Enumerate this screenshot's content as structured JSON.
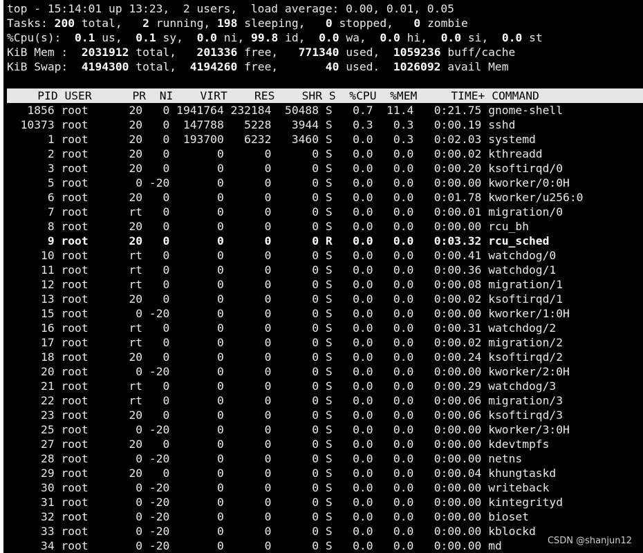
{
  "summary": {
    "line1": "top - 15:14:01 up 13:23,  2 users,  load average: 0.00, 0.01, 0.05",
    "tasks": {
      "label": "Tasks:",
      "total": "200",
      "total_lbl": "total,",
      "running": "2",
      "running_lbl": "running,",
      "sleeping": "198",
      "sleeping_lbl": "sleeping,",
      "stopped": "0",
      "stopped_lbl": "stopped,",
      "zombie": "0",
      "zombie_lbl": "zombie"
    },
    "cpu": {
      "label": "%Cpu(s):",
      "us": "0.1",
      "us_lbl": "us,",
      "sy": "0.1",
      "sy_lbl": "sy,",
      "ni": "0.0",
      "ni_lbl": "ni,",
      "id": "99.8",
      "id_lbl": "id,",
      "wa": "0.0",
      "wa_lbl": "wa,",
      "hi": "0.0",
      "hi_lbl": "hi,",
      "si": "0.0",
      "si_lbl": "si,",
      "st": "0.0",
      "st_lbl": "st"
    },
    "mem": {
      "label": "KiB Mem :",
      "total": "2031912",
      "total_lbl": "total,",
      "free": "201336",
      "free_lbl": "free,",
      "used": "771340",
      "used_lbl": "used,",
      "buff": "1059236",
      "buff_lbl": "buff/cache"
    },
    "swap": {
      "label": "KiB Swap:",
      "total": "4194300",
      "total_lbl": "total,",
      "free": "4194260",
      "free_lbl": "free,",
      "used": "40",
      "used_lbl": "used.",
      "avail": "1026092",
      "avail_lbl": "avail Mem"
    }
  },
  "columns": [
    "PID",
    "USER",
    "PR",
    "NI",
    "VIRT",
    "RES",
    "SHR",
    "S",
    "%CPU",
    "%MEM",
    "TIME+",
    "COMMAND"
  ],
  "processes": [
    [
      "1856",
      "root",
      "20",
      "0",
      "1941764",
      "232184",
      "50488",
      "S",
      "0.7",
      "11.4",
      "0:21.75",
      "gnome-shell"
    ],
    [
      "10373",
      "root",
      "20",
      "0",
      "147788",
      "5228",
      "3944",
      "S",
      "0.3",
      "0.3",
      "0:00.19",
      "sshd"
    ],
    [
      "1",
      "root",
      "20",
      "0",
      "193700",
      "6232",
      "3460",
      "S",
      "0.0",
      "0.3",
      "0:02.03",
      "systemd"
    ],
    [
      "2",
      "root",
      "20",
      "0",
      "0",
      "0",
      "0",
      "S",
      "0.0",
      "0.0",
      "0:00.02",
      "kthreadd"
    ],
    [
      "3",
      "root",
      "20",
      "0",
      "0",
      "0",
      "0",
      "S",
      "0.0",
      "0.0",
      "0:00.20",
      "ksoftirqd/0"
    ],
    [
      "5",
      "root",
      "0",
      "-20",
      "0",
      "0",
      "0",
      "S",
      "0.0",
      "0.0",
      "0:00.00",
      "kworker/0:0H"
    ],
    [
      "6",
      "root",
      "20",
      "0",
      "0",
      "0",
      "0",
      "S",
      "0.0",
      "0.0",
      "0:01.78",
      "kworker/u256:0"
    ],
    [
      "7",
      "root",
      "rt",
      "0",
      "0",
      "0",
      "0",
      "S",
      "0.0",
      "0.0",
      "0:00.01",
      "migration/0"
    ],
    [
      "8",
      "root",
      "20",
      "0",
      "0",
      "0",
      "0",
      "S",
      "0.0",
      "0.0",
      "0:00.00",
      "rcu_bh"
    ],
    [
      "9",
      "root",
      "20",
      "0",
      "0",
      "0",
      "0",
      "R",
      "0.0",
      "0.0",
      "0:03.32",
      "rcu_sched"
    ],
    [
      "10",
      "root",
      "rt",
      "0",
      "0",
      "0",
      "0",
      "S",
      "0.0",
      "0.0",
      "0:00.41",
      "watchdog/0"
    ],
    [
      "11",
      "root",
      "rt",
      "0",
      "0",
      "0",
      "0",
      "S",
      "0.0",
      "0.0",
      "0:00.36",
      "watchdog/1"
    ],
    [
      "12",
      "root",
      "rt",
      "0",
      "0",
      "0",
      "0",
      "S",
      "0.0",
      "0.0",
      "0:00.08",
      "migration/1"
    ],
    [
      "13",
      "root",
      "20",
      "0",
      "0",
      "0",
      "0",
      "S",
      "0.0",
      "0.0",
      "0:00.02",
      "ksoftirqd/1"
    ],
    [
      "15",
      "root",
      "0",
      "-20",
      "0",
      "0",
      "0",
      "S",
      "0.0",
      "0.0",
      "0:00.00",
      "kworker/1:0H"
    ],
    [
      "16",
      "root",
      "rt",
      "0",
      "0",
      "0",
      "0",
      "S",
      "0.0",
      "0.0",
      "0:00.31",
      "watchdog/2"
    ],
    [
      "17",
      "root",
      "rt",
      "0",
      "0",
      "0",
      "0",
      "S",
      "0.0",
      "0.0",
      "0:00.02",
      "migration/2"
    ],
    [
      "18",
      "root",
      "20",
      "0",
      "0",
      "0",
      "0",
      "S",
      "0.0",
      "0.0",
      "0:00.24",
      "ksoftirqd/2"
    ],
    [
      "20",
      "root",
      "0",
      "-20",
      "0",
      "0",
      "0",
      "S",
      "0.0",
      "0.0",
      "0:00.00",
      "kworker/2:0H"
    ],
    [
      "21",
      "root",
      "rt",
      "0",
      "0",
      "0",
      "0",
      "S",
      "0.0",
      "0.0",
      "0:00.29",
      "watchdog/3"
    ],
    [
      "22",
      "root",
      "rt",
      "0",
      "0",
      "0",
      "0",
      "S",
      "0.0",
      "0.0",
      "0:00.06",
      "migration/3"
    ],
    [
      "23",
      "root",
      "20",
      "0",
      "0",
      "0",
      "0",
      "S",
      "0.0",
      "0.0",
      "0:00.06",
      "ksoftirqd/3"
    ],
    [
      "25",
      "root",
      "0",
      "-20",
      "0",
      "0",
      "0",
      "S",
      "0.0",
      "0.0",
      "0:00.00",
      "kworker/3:0H"
    ],
    [
      "27",
      "root",
      "20",
      "0",
      "0",
      "0",
      "0",
      "S",
      "0.0",
      "0.0",
      "0:00.00",
      "kdevtmpfs"
    ],
    [
      "28",
      "root",
      "0",
      "-20",
      "0",
      "0",
      "0",
      "S",
      "0.0",
      "0.0",
      "0:00.00",
      "netns"
    ],
    [
      "29",
      "root",
      "20",
      "0",
      "0",
      "0",
      "0",
      "S",
      "0.0",
      "0.0",
      "0:00.04",
      "khungtaskd"
    ],
    [
      "30",
      "root",
      "0",
      "-20",
      "0",
      "0",
      "0",
      "S",
      "0.0",
      "0.0",
      "0:00.00",
      "writeback"
    ],
    [
      "31",
      "root",
      "0",
      "-20",
      "0",
      "0",
      "0",
      "S",
      "0.0",
      "0.0",
      "0:00.00",
      "kintegrityd"
    ],
    [
      "32",
      "root",
      "0",
      "-20",
      "0",
      "0",
      "0",
      "S",
      "0.0",
      "0.0",
      "0:00.00",
      "bioset"
    ],
    [
      "33",
      "root",
      "0",
      "-20",
      "0",
      "0",
      "0",
      "S",
      "0.0",
      "0.0",
      "0:00.00",
      "kblockd"
    ],
    [
      "34",
      "root",
      "0",
      "-20",
      "0",
      "0",
      "0",
      "S",
      "0.0",
      "0.0",
      "0:00.00",
      "md"
    ]
  ],
  "watermark": "CSDN @shanjun12",
  "colors": {
    "background": "#000000",
    "text": "#e8e8e8",
    "header_bg": "#e6e6e6",
    "header_text": "#000000"
  }
}
